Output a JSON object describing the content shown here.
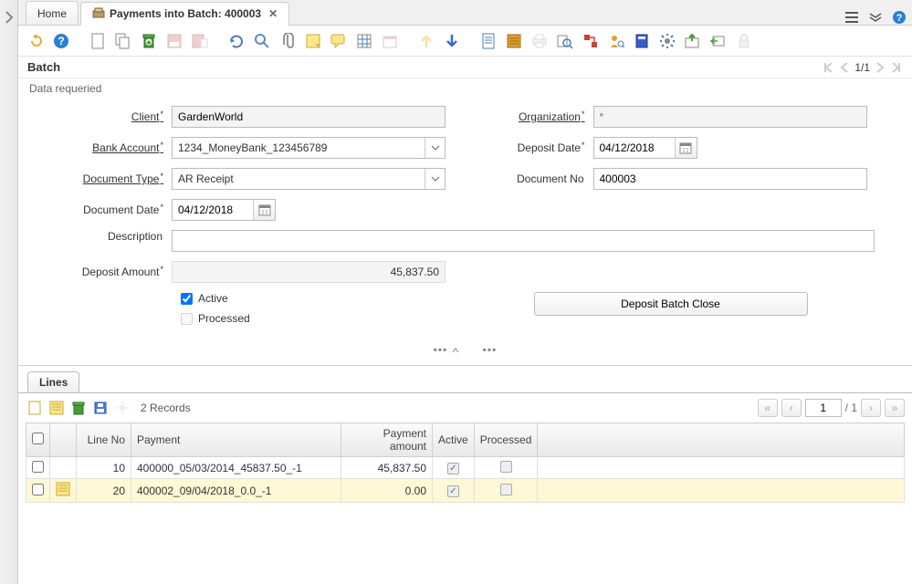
{
  "tabs": {
    "home": "Home",
    "active_title": "Payments into Batch: 400003"
  },
  "toolbar_icons": [
    "undo",
    "help",
    "new",
    "copy",
    "delete",
    "save",
    "save-new",
    "refresh",
    "search",
    "attach",
    "note",
    "chat",
    "grid",
    "calendar",
    "arrow-up",
    "arrow-down",
    "single",
    "multi",
    "print",
    "lookup",
    "wf",
    "process",
    "archive",
    "customize",
    "export",
    "back",
    "lock"
  ],
  "batch": {
    "section_title": "Batch",
    "nav": "1/1",
    "status": "Data requeried"
  },
  "form": {
    "client_label": "Client",
    "client_value": "GardenWorld",
    "org_label": "Organization",
    "org_placeholder": "*",
    "bank_label": "Bank Account",
    "bank_value": "1234_MoneyBank_123456789",
    "deposit_date_label": "Deposit Date",
    "deposit_date_value": "04/12/2018",
    "doctype_label": "Document Type",
    "doctype_value": "AR Receipt",
    "docno_label": "Document No",
    "docno_value": "400003",
    "docdate_label": "Document Date",
    "docdate_value": "04/12/2018",
    "desc_label": "Description",
    "desc_value": "",
    "amount_label": "Deposit Amount",
    "amount_value": "45,837.50",
    "active_label": "Active",
    "processed_label": "Processed",
    "deposit_close_btn": "Deposit Batch Close"
  },
  "lines": {
    "tab_label": "Lines",
    "records_text": "2 Records",
    "page": "1",
    "page_of": "/ 1",
    "headers": {
      "line_no": "Line No",
      "payment": "Payment",
      "payment_amount": "Payment amount",
      "active": "Active",
      "processed": "Processed"
    },
    "rows": [
      {
        "line_no": "10",
        "payment": "400000_05/03/2014_45837.50_-1",
        "amount": "45,837.50",
        "active": true,
        "processed": false,
        "selected": false
      },
      {
        "line_no": "20",
        "payment": "400002_09/04/2018_0.0_-1",
        "amount": "0.00",
        "active": true,
        "processed": false,
        "selected": true
      }
    ]
  }
}
